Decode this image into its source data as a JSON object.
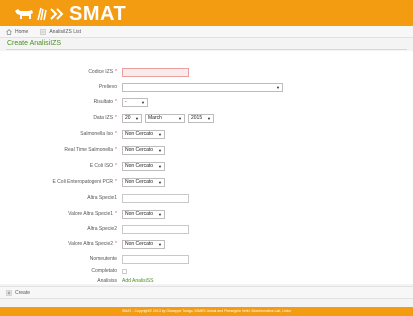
{
  "header": {
    "app_name": "SMAT"
  },
  "breadcrumb": {
    "home": "Home",
    "current": "AnalisiIZS List"
  },
  "page": {
    "title": "Create AnalisiIZS"
  },
  "form": {
    "codice_izs": {
      "label": "Codice IZS",
      "value": ""
    },
    "prelievo": {
      "label": "Prelievo",
      "value": ""
    },
    "risultato": {
      "label": "Risultato",
      "value": "-"
    },
    "data_izs": {
      "label": "Data IZS",
      "day": "20",
      "month": "March",
      "year": "2015"
    },
    "salmonella_iso": {
      "label": "Salmonella Iso",
      "value": "Non Cercato"
    },
    "real_time_salmonella": {
      "label": "Real Time Salmonella",
      "value": "Non Cercato"
    },
    "e_coli_iso": {
      "label": "E Coli ISO",
      "value": "Non Cercato"
    },
    "e_coli_pcr": {
      "label": "E Coli Enteropatogeni PCR",
      "value": "Non Cercato"
    },
    "altra_specie1": {
      "label": "Altra Specie1",
      "value": ""
    },
    "valore_altra_specie1": {
      "label": "Valore Altra Specie1",
      "value": "Non Cercato"
    },
    "altra_specie2": {
      "label": "Altra Specie2",
      "value": ""
    },
    "valore_altra_specie2": {
      "label": "Valore Altra Specie2",
      "value": "Non Cercato"
    },
    "nomeutente": {
      "label": "Nomeutente",
      "value": ""
    },
    "completato": {
      "label": "Completato",
      "checked": false
    },
    "analisiss": {
      "label": "Analisiss",
      "link": "Add AnalisiSS"
    },
    "required_mark": "*"
  },
  "actions": {
    "create": "Create"
  },
  "footer": {
    "text": "SMAT - Copyright© 2013 by Giuseppe Tonlgo, DIMES Unical and Pierangelo Veltri, Bioinformatics Lab, Unicz"
  },
  "colors": {
    "brand": "#f39c12",
    "accent": "#4a8f23",
    "error": "#e74c3c"
  },
  "icons": {
    "logo": "cow-wheat-arrows-icon",
    "home": "home-icon",
    "list": "list-icon",
    "create": "plus-icon"
  }
}
